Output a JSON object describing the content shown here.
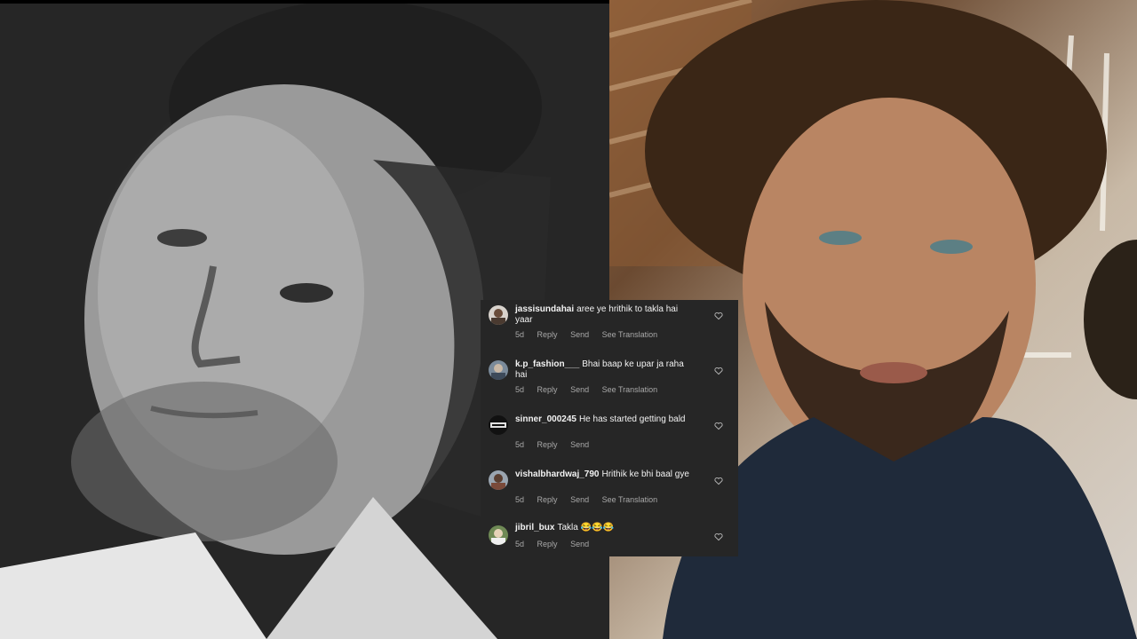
{
  "comments": [
    {
      "username": "jassisundahai",
      "text": "aree ye hrithik to takla hai yaar",
      "time": "5d",
      "reply": "Reply",
      "send": "Send",
      "translate": "See Translation"
    },
    {
      "username": "k.p_fashion___",
      "text": "Bhai baap ke upar ja raha hai",
      "time": "5d",
      "reply": "Reply",
      "send": "Send",
      "translate": "See Translation"
    },
    {
      "username": "sinner_000245",
      "text": "He has started getting bald",
      "time": "5d",
      "reply": "Reply",
      "send": "Send"
    },
    {
      "username": "vishalbhardwaj_790",
      "text": "Hrithik ke bhi baal gye",
      "time": "5d",
      "reply": "Reply",
      "send": "Send",
      "translate": "See Translation"
    },
    {
      "username": "jibril_bux",
      "text": "Takla 😂😂😂",
      "time": "5d",
      "reply": "Reply",
      "send": "Send"
    }
  ],
  "icons": {
    "like": "heart-outline-icon"
  },
  "colors": {
    "panel_bg": "#262626",
    "meta_text": "#a8a8a8"
  }
}
